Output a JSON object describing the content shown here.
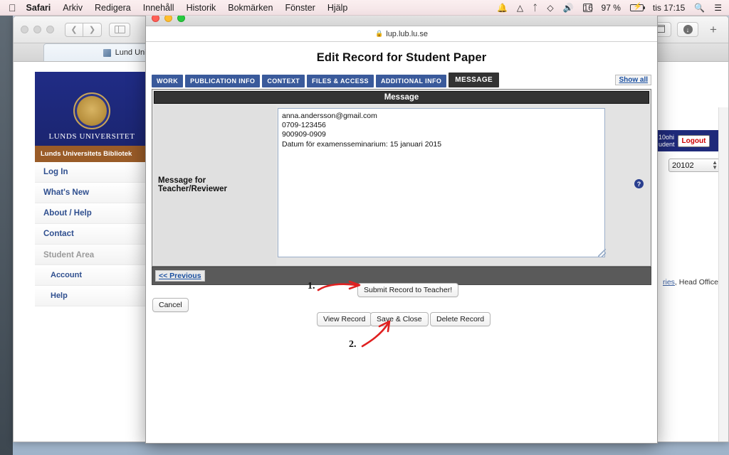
{
  "menubar": {
    "apple_icon": "apple-icon",
    "items": [
      "Safari",
      "Arkiv",
      "Redigera",
      "Innehåll",
      "Historik",
      "Bokmärken",
      "Fönster",
      "Hjälp"
    ],
    "status_icons": [
      "bell-icon",
      "google-drive-icon",
      "bluetooth-icon",
      "dropbox-icon",
      "volume-icon",
      "calendar-icon"
    ],
    "battery": "97 %",
    "battery_icon": "battery-charging-icon",
    "clock": "tis 17:15",
    "search_icon": "search-icon",
    "notification_center_icon": "list-icon"
  },
  "background_window": {
    "toolbar": {
      "back_icon": "chevron-left-icon",
      "forward_icon": "chevron-right-icon",
      "sidebar_icon": "sidebar-icon",
      "tab_overview_icon": "tab-overview-icon",
      "downloads_icon": "downloads-icon",
      "new_tab_label": "+"
    },
    "tab_title": "Lund University",
    "site": {
      "banner_name": "LUNDS UNIVERSITET",
      "library_bar": "Lunds Universitets Bibliotek",
      "nav": [
        "Log In",
        "What's New",
        "About / Help",
        "Contact"
      ],
      "group_heading": "Student Area",
      "sub_nav": [
        "Account",
        "Help"
      ],
      "user_line1": "10ohi",
      "user_line2": "udent",
      "logout_label": "Logout",
      "select_value": "20102",
      "footer_link": "ries",
      "footer_text": ", Head Office"
    }
  },
  "dialog": {
    "url": "lup.lub.lu.se",
    "lock_icon": "lock-icon",
    "page_title": "Edit Record for Student Paper",
    "tabs": [
      {
        "label": "WORK",
        "active": false
      },
      {
        "label": "PUBLICATION INFO",
        "active": false
      },
      {
        "label": "CONTEXT",
        "active": false
      },
      {
        "label": "FILES & ACCESS",
        "active": false
      },
      {
        "label": "ADDITIONAL INFO",
        "active": false
      },
      {
        "label": "MESSAGE",
        "active": true
      }
    ],
    "show_all_label": "Show all",
    "panel": {
      "header": "Message",
      "field_label": "Message for Teacher/Reviewer",
      "textarea_value": "anna.andersson@gmail.com\n0709-123456\n900909-0909\nDatum för examensseminarium: 15 januari 2015",
      "help_icon": "help-icon"
    },
    "previous_label": "<< Previous",
    "buttons": {
      "submit": "Submit Record to Teacher!",
      "cancel": "Cancel",
      "view": "View Record",
      "save": "Save & Close",
      "delete": "Delete Record"
    },
    "annotations": [
      {
        "label": "1.",
        "target": "submit-record-button",
        "color": "#e02020"
      },
      {
        "label": "2.",
        "target": "save-and-close-button",
        "color": "#e02020"
      }
    ]
  }
}
